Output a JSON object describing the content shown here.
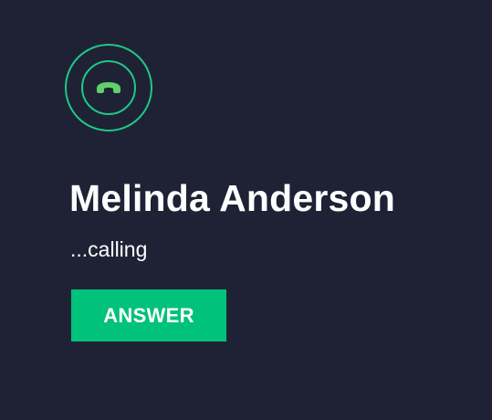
{
  "call": {
    "caller_name": "Melinda Anderson",
    "status_text": "...calling",
    "answer_label": "ANSWER"
  },
  "icons": {
    "call_indicator": "phone-handset-icon"
  },
  "colors": {
    "background": "#1f2235",
    "ring": "#1fc78a",
    "phone_icon": "#5fd06a",
    "answer_button": "#00c27a",
    "text": "#ffffff"
  }
}
